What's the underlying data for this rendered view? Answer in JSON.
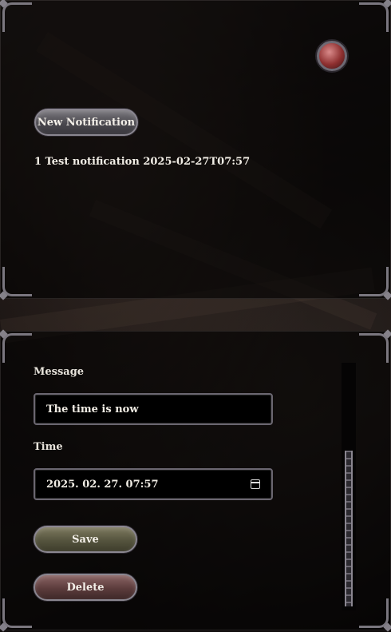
{
  "top_panel": {
    "new_notification_label": "New Notification",
    "notification_item": "1 Test notification 2025-02-27T07:57"
  },
  "form": {
    "message_label": "Message",
    "message_value": "The time is now",
    "time_label": "Time",
    "time_value": "2025. 02. 27. 07:57",
    "save_label": "Save",
    "delete_label": "Delete"
  },
  "icons": {
    "orb": "red-orb-icon",
    "calendar": "calendar-icon"
  },
  "colors": {
    "orb": "#8e3030",
    "save_button": "#55543e",
    "delete_button": "#5c3c3c",
    "neutral_button": "#4a484e"
  }
}
